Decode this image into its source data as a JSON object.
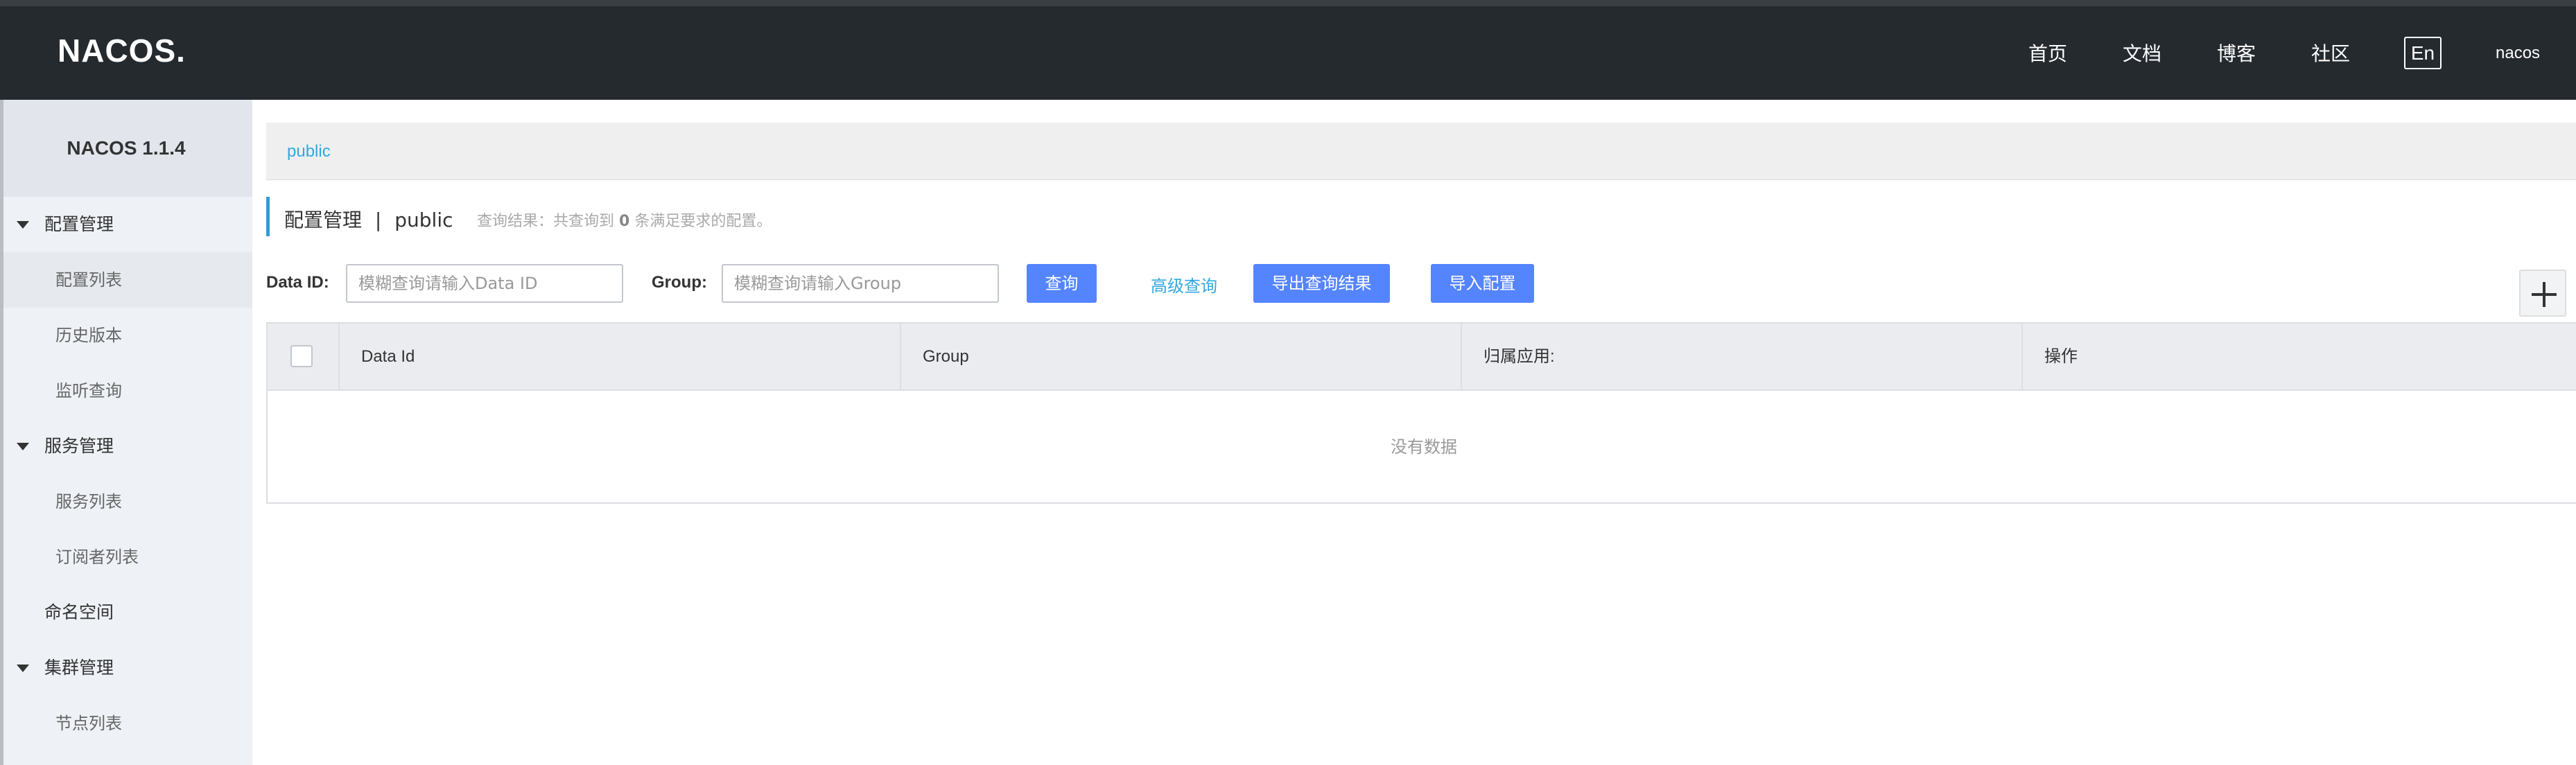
{
  "header": {
    "logo": "NACOS.",
    "nav": [
      "首页",
      "文档",
      "博客",
      "社区"
    ],
    "lang_label": "En",
    "user": "nacos"
  },
  "sidebar": {
    "title": "NACOS 1.1.4",
    "groups": [
      {
        "label": "配置管理",
        "items": [
          "配置列表",
          "历史版本",
          "监听查询"
        ]
      },
      {
        "label": "服务管理",
        "items": [
          "服务列表",
          "订阅者列表"
        ]
      },
      {
        "label": "命名空间"
      },
      {
        "label": "集群管理",
        "items": [
          "节点列表"
        ]
      }
    ],
    "active_item": "配置列表"
  },
  "namespace": {
    "current": "public"
  },
  "page": {
    "title": "配置管理",
    "separator": "|",
    "namespace": "public",
    "result_prefix": "查询结果：共查询到",
    "result_count": "0",
    "result_suffix": "条满足要求的配置。"
  },
  "filters": {
    "data_id_label": "Data ID:",
    "data_id_placeholder": "模糊查询请输入Data ID",
    "group_label": "Group:",
    "group_placeholder": "模糊查询请输入Group",
    "query_button": "查询",
    "advanced_link": "高级查询",
    "export_button": "导出查询结果",
    "import_button": "导入配置"
  },
  "table": {
    "columns": [
      "Data Id",
      "Group",
      "归属应用:",
      "操作"
    ],
    "empty_text": "没有数据"
  },
  "colors": {
    "topbar": "#252a2f",
    "sidebar": "#eef1f5",
    "primary_button": "#5584ff",
    "link": "#33a8e0",
    "title_accent": "#2e9cd8"
  }
}
